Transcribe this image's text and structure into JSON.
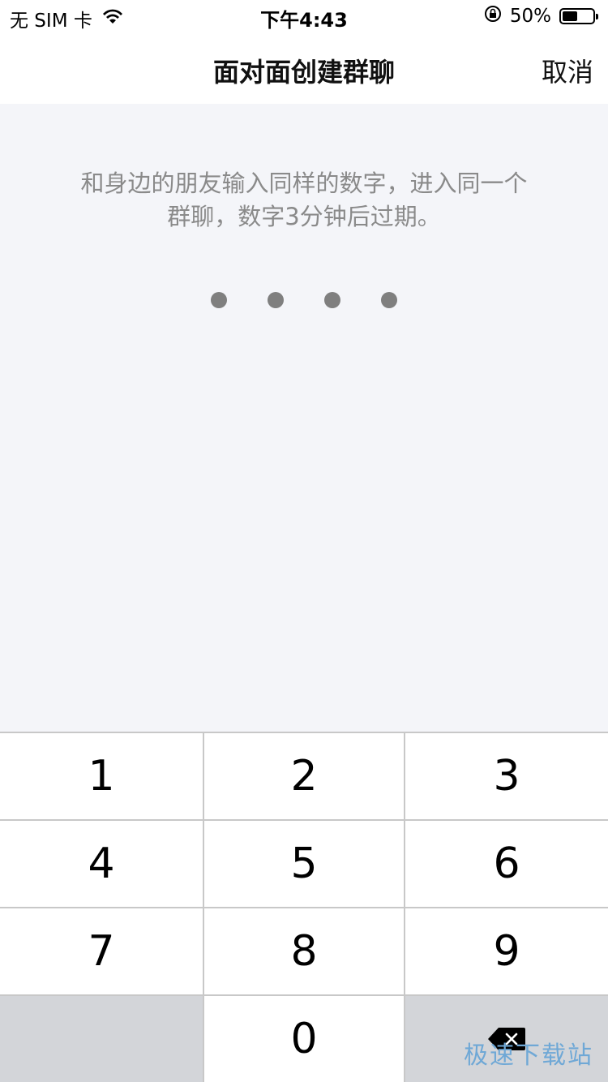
{
  "status_bar": {
    "carrier": "无 SIM 卡",
    "time": "下午4:43",
    "battery_percent_text": "50%",
    "battery_level": 0.5,
    "icons": [
      "wifi-icon",
      "orientation-lock-icon",
      "battery-icon"
    ]
  },
  "nav": {
    "title": "面对面创建群聊",
    "cancel_label": "取消"
  },
  "content": {
    "hint_line1": "和身边的朋友输入同样的数字，进入同一个",
    "hint_line2": "群聊，数字3分钟后过期。",
    "pin_length": 4
  },
  "keypad": {
    "keys": [
      "1",
      "2",
      "3",
      "4",
      "5",
      "6",
      "7",
      "8",
      "9",
      "",
      "0",
      "backspace"
    ],
    "backspace_icon": "backspace-icon"
  },
  "watermark": {
    "text": "极速下载站"
  },
  "colors": {
    "background": "#f4f5f9",
    "hint_text": "#8a8a8a",
    "pin_dot": "#7f7f7f",
    "key_bg": "#ffffff",
    "key_gray_bg": "#d3d5d9",
    "watermark": "#6fa8d6"
  }
}
